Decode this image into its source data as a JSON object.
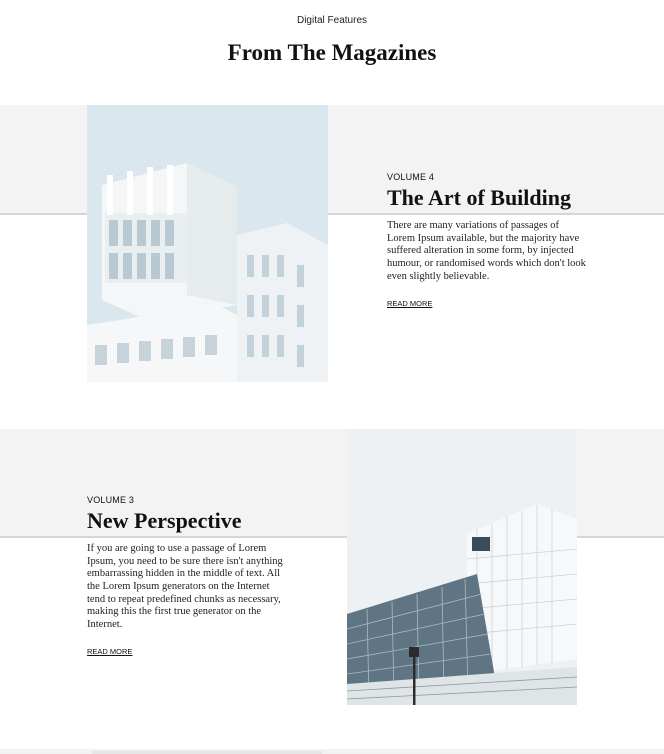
{
  "header": {
    "eyebrow": "Digital Features",
    "title": "From The Magazines"
  },
  "articles": [
    {
      "volume": "VOLUME 4",
      "title": "The Art of Building",
      "excerpt": "There are many variations of passages of Lorem Ipsum available, but the majority have suffered alteration in some form, by injected humour, or randomised words which don't look even slightly believable.",
      "link": "READ MORE",
      "image": "white-modular-building-photo"
    },
    {
      "volume": "VOLUME 3",
      "title": "New Perspective",
      "excerpt": "If you are going to use a passage of Lorem Ipsum, you need to be sure there isn't anything embarrassing hidden in the middle of text. All the Lorem Ipsum generators on the Internet tend to repeat predefined chunks as necessary, making this the first true generator on the Internet.",
      "link": "READ MORE",
      "image": "glass-facade-building-photo"
    }
  ]
}
